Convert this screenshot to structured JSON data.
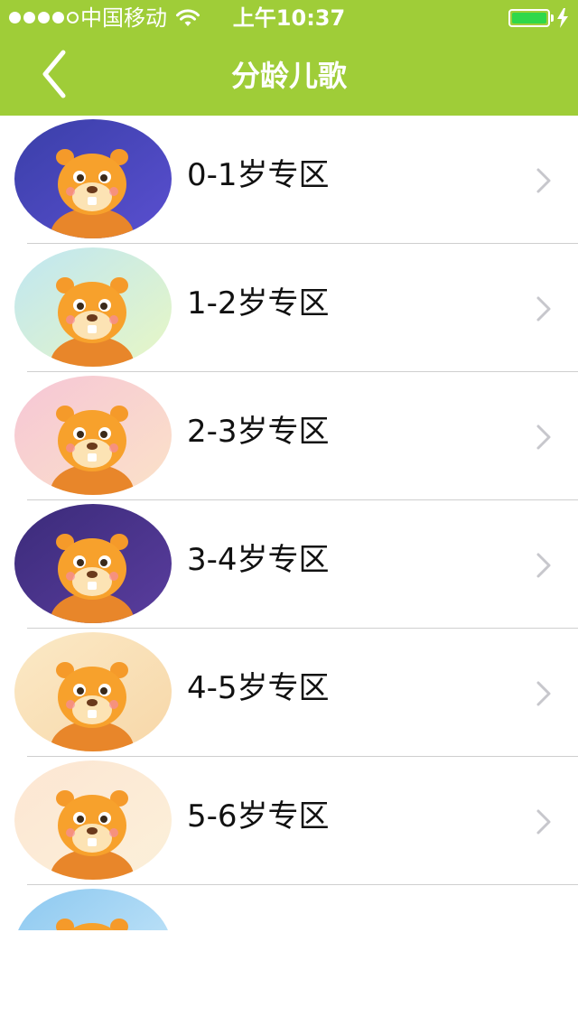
{
  "status_bar": {
    "carrier": "中国移动",
    "time": "上午10:37",
    "signal_bars_filled": 4,
    "signal_bars_total": 5,
    "battery_level": 1.0
  },
  "nav": {
    "title": "分龄儿歌",
    "back_icon": "chevron-left-icon"
  },
  "colors": {
    "accent": "#9fcd38",
    "battery": "#2fd84a",
    "divider": "#cfcfcf",
    "chevron": "#c7c7cc"
  },
  "items": [
    {
      "label": "0-1岁专区",
      "thumb_bg": "#3a3fa8",
      "thumb_bg2": "#5a4fd0"
    },
    {
      "label": "1-2岁专区",
      "thumb_bg": "#bfe6f2",
      "thumb_bg2": "#e8f7c4"
    },
    {
      "label": "2-3岁专区",
      "thumb_bg": "#f6c6d6",
      "thumb_bg2": "#fbe2c8"
    },
    {
      "label": "3-4岁专区",
      "thumb_bg": "#3b2b7a",
      "thumb_bg2": "#5a3d9e"
    },
    {
      "label": "4-5岁专区",
      "thumb_bg": "#fbe9c6",
      "thumb_bg2": "#f7d7a8"
    },
    {
      "label": "5-6岁专区",
      "thumb_bg": "#fde6d3",
      "thumb_bg2": "#fbf0d9"
    },
    {
      "label": "",
      "thumb_bg": "#8cc8f0",
      "thumb_bg2": "#cdeafa"
    }
  ]
}
